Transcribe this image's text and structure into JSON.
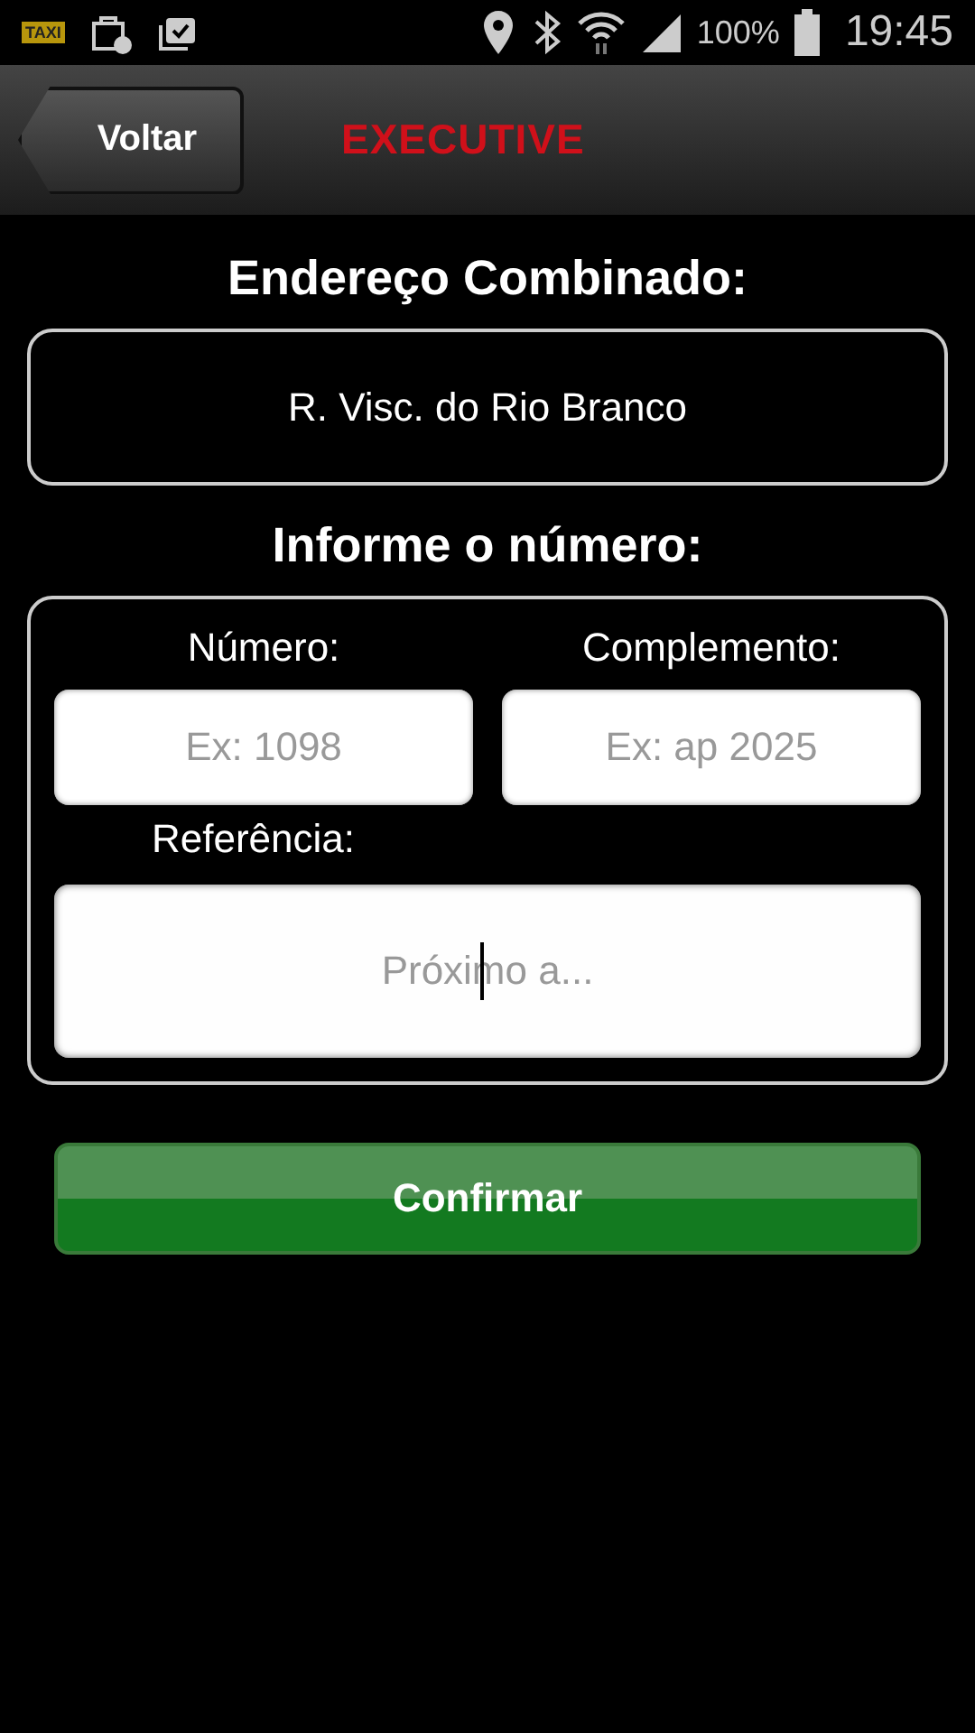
{
  "status_bar": {
    "app_badge": "TAXI",
    "battery": "100%",
    "time": "19:45"
  },
  "header": {
    "back_button": "Voltar",
    "logo": "EXECUTIVE"
  },
  "address": {
    "title": "Endereço Combinado:",
    "value": "R. Visc. do Rio Branco"
  },
  "number_form": {
    "title": "Informe o número:",
    "fields": [
      {
        "label": "Número:",
        "placeholder": "Ex: 1098",
        "focused": false
      },
      {
        "label": "Complemento:",
        "placeholder": "Ex: ap 2025",
        "focused": false
      },
      {
        "label": "Referência:",
        "placeholder": "Próximo a...",
        "focused": true
      }
    ]
  },
  "confirm_button": "Confirmar"
}
